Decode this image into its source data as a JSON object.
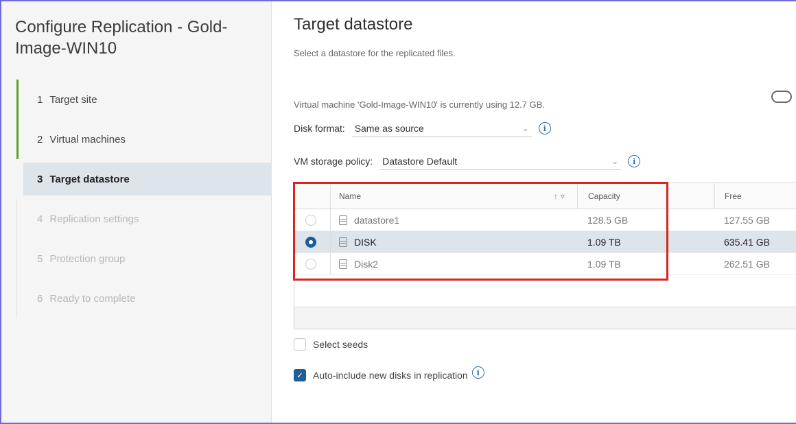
{
  "wizard": {
    "title": "Configure Replication - Gold-Image-WIN10"
  },
  "steps": [
    {
      "num": "1",
      "label": "Target site",
      "state": "done"
    },
    {
      "num": "2",
      "label": "Virtual machines",
      "state": "done"
    },
    {
      "num": "3",
      "label": "Target datastore",
      "state": "active"
    },
    {
      "num": "4",
      "label": "Replication settings",
      "state": "future"
    },
    {
      "num": "5",
      "label": "Protection group",
      "state": "future"
    },
    {
      "num": "6",
      "label": "Ready to complete",
      "state": "future"
    }
  ],
  "page": {
    "title": "Target datastore",
    "subtitle": "Select a datastore for the replicated files.",
    "usage": "Virtual machine 'Gold-Image-WIN10' is currently using 12.7 GB."
  },
  "disk_format": {
    "label": "Disk format:",
    "value": "Same as source"
  },
  "storage_policy": {
    "label": "VM storage policy:",
    "value": "Datastore Default"
  },
  "grid": {
    "columns": {
      "name": "Name",
      "capacity": "Capacity",
      "free": "Free"
    },
    "rows": [
      {
        "name": "datastore1",
        "capacity": "128.5 GB",
        "free": "127.55 GB",
        "selected": false
      },
      {
        "name": "DISK",
        "capacity": "1.09 TB",
        "free": "635.41 GB",
        "selected": true
      },
      {
        "name": "Disk2",
        "capacity": "1.09 TB",
        "free": "262.51 GB",
        "selected": false
      }
    ]
  },
  "options": {
    "select_seeds": {
      "label": "Select seeds",
      "checked": false
    },
    "auto_include": {
      "label": "Auto-include new disks in replication",
      "checked": true
    }
  },
  "colors": {
    "accent": "#1f5c98",
    "highlight": "#d9231b",
    "done": "#5aa220"
  }
}
